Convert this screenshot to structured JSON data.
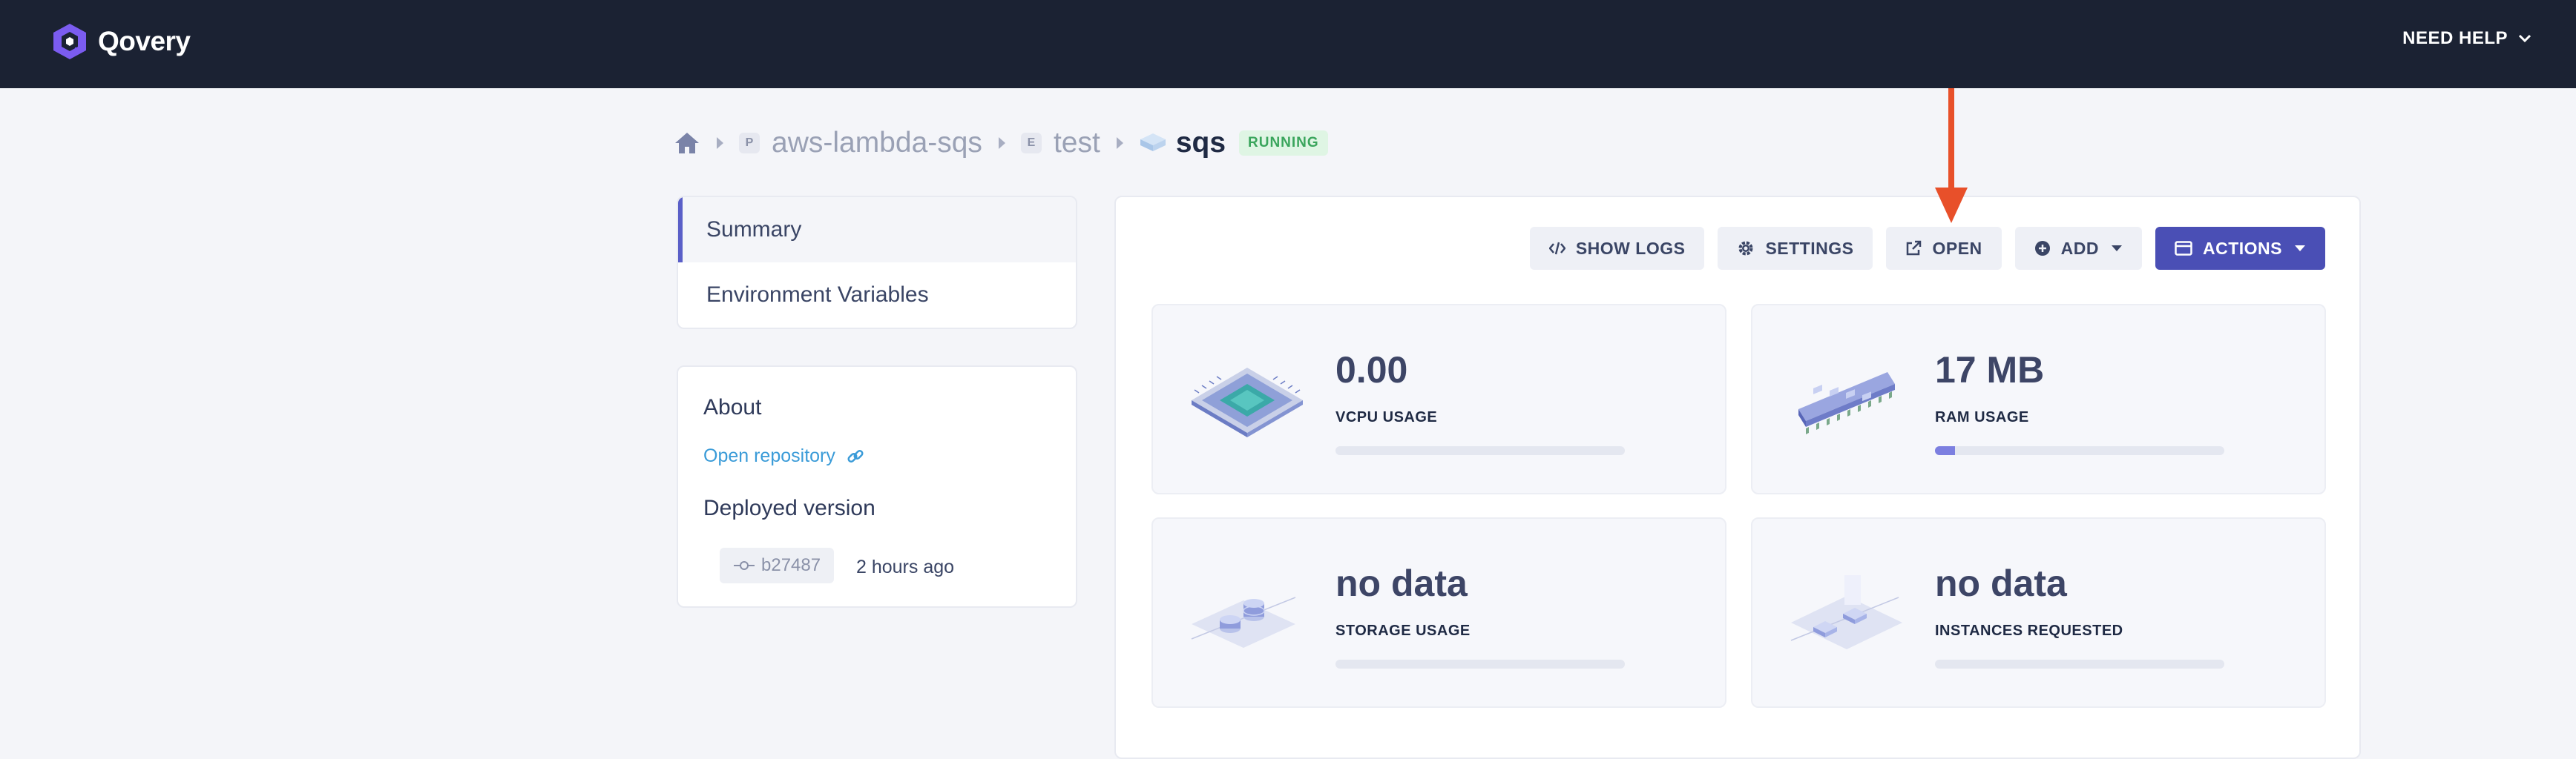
{
  "topbar": {
    "brand": "Qovery",
    "help_label": "NEED HELP"
  },
  "breadcrumb": {
    "project_badge": "P",
    "project": "aws-lambda-sqs",
    "environment_badge": "E",
    "environment": "test",
    "application": "sqs",
    "status": "RUNNING"
  },
  "sidebar": {
    "items": [
      {
        "label": "Summary",
        "active": true
      },
      {
        "label": "Environment Variables",
        "active": false
      }
    ]
  },
  "about": {
    "title": "About",
    "repo_link": "Open repository",
    "deployed_title": "Deployed version",
    "commit": "b27487",
    "commit_time": "2 hours ago"
  },
  "toolbar": {
    "show_logs": "SHOW LOGS",
    "settings": "SETTINGS",
    "open": "OPEN",
    "add": "ADD",
    "actions": "ACTIONS"
  },
  "metrics": {
    "vcpu": {
      "value": "0.00",
      "label": "VCPU USAGE",
      "fill_percent": 0
    },
    "ram": {
      "value": "17 MB",
      "label": "RAM USAGE",
      "fill_percent": 7
    },
    "storage": {
      "value": "no data",
      "label": "STORAGE USAGE",
      "fill_percent": 0
    },
    "instances": {
      "value": "no data",
      "label": "INSTANCES REQUESTED",
      "fill_percent": 0
    }
  },
  "colors": {
    "topbar": "#1b2233",
    "accent": "#4a4fb5",
    "status_running": "#3aa55c",
    "annotation_arrow": "#e8502a"
  },
  "icons": {
    "brand": "qovery-logo-icon",
    "help": "chevron-down-icon",
    "home": "home-icon",
    "application": "stack-icon",
    "show_logs": "code-icon",
    "settings": "gear-icon",
    "open": "external-link-icon",
    "add": "plus-circle-icon",
    "actions": "window-icon"
  }
}
